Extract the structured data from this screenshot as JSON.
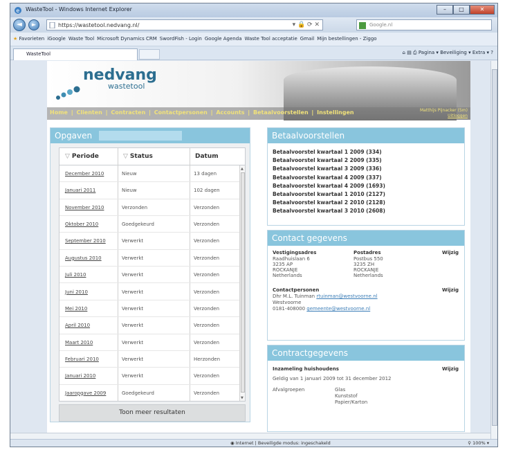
{
  "window": {
    "title": "WasteTool - Windows Internet Explorer",
    "btn_min": "–",
    "btn_max": "□",
    "btn_close": "✕"
  },
  "nav": {
    "back": "◄",
    "forward": "►",
    "address": "https://wastetool.nedvang.nl/",
    "search_placeholder": "Google.nl"
  },
  "favorites": {
    "label": "Favorieten",
    "items": [
      "iGoogle",
      "Waste Tool",
      "Microsoft Dynamics CRM",
      "SwordFish - Login",
      "Google Agenda",
      "Waste Tool acceptatie",
      "Gmail",
      "Mijn bestellingen - Ziggo"
    ]
  },
  "tab": {
    "label": "WasteTool"
  },
  "commandbar": {
    "pagina": "Pagina ▾",
    "beveiliging": "Beveiliging ▾",
    "extra": "Extra ▾"
  },
  "site": {
    "logo_main": "nedvang",
    "logo_sub": "wastetool",
    "menu": [
      "Home",
      "Clienten",
      "Contracten",
      "Contactpersonen",
      "Accounts",
      "Betaalvoorstellen",
      "Instellingen"
    ],
    "user": "Matthijs Pijnacker (5m)",
    "logout": "Uitloggen"
  },
  "opgaven": {
    "title": "Opgaven",
    "columns": [
      "Periode",
      "Status",
      "Datum"
    ],
    "rows": [
      {
        "periode": "December 2010",
        "status": "Nieuw",
        "datum": "13 dagen"
      },
      {
        "periode": "Januari 2011",
        "status": "Nieuw",
        "datum": "102 dagen"
      },
      {
        "periode": "November 2010",
        "status": "Verzonden",
        "datum": "Verzonden"
      },
      {
        "periode": "Oktober 2010",
        "status": "Goedgekeurd",
        "datum": "Verzonden"
      },
      {
        "periode": "September 2010",
        "status": "Verwerkt",
        "datum": "Verzonden"
      },
      {
        "periode": "Augustus 2010",
        "status": "Verwerkt",
        "datum": "Verzonden"
      },
      {
        "periode": "Juli 2010",
        "status": "Verwerkt",
        "datum": "Verzonden"
      },
      {
        "periode": "Juni 2010",
        "status": "Verwerkt",
        "datum": "Verzonden"
      },
      {
        "periode": "Mei 2010",
        "status": "Verwerkt",
        "datum": "Verzonden"
      },
      {
        "periode": "April 2010",
        "status": "Verwerkt",
        "datum": "Verzonden"
      },
      {
        "periode": "Maart 2010",
        "status": "Verwerkt",
        "datum": "Verzonden"
      },
      {
        "periode": "Februari 2010",
        "status": "Verwerkt",
        "datum": "Herzonden"
      },
      {
        "periode": "Januari 2010",
        "status": "Verwerkt",
        "datum": "Verzonden"
      },
      {
        "periode": "Jaaropgave 2009",
        "status": "Goedgekeurd",
        "datum": "Verzonden"
      }
    ],
    "more_button": "Toon meer resultaten"
  },
  "betaalvoorstellen": {
    "title": "Betaalvoorstellen",
    "items": [
      "Betaalvoorstel kwartaal 1 2009 (334)",
      "Betaalvoorstel kwartaal 2 2009 (335)",
      "Betaalvoorstel kwartaal 3 2009 (336)",
      "Betaalvoorstel kwartaal 4 2009 (337)",
      "Betaalvoorstel kwartaal 4 2009 (1693)",
      "Betaalvoorstel kwartaal 1 2010 (2127)",
      "Betaalvoorstel kwartaal 2 2010 (2128)",
      "Betaalvoorstel kwartaal 3 2010 (2608)"
    ]
  },
  "contact": {
    "title": "Contact gegevens",
    "vestiging_label": "Vestigingsadres",
    "vestiging": [
      "Raadhuislaan 6",
      "3235 AP",
      "ROCKANJE",
      "Netherlands"
    ],
    "post_label": "Postadres",
    "post": [
      "Postbus 550",
      "3235 ZH",
      "ROCKANJE",
      "Netherlands"
    ],
    "wijzig": "Wijzig",
    "persons_label": "Contactpersonen",
    "person_name": "Dhr M.L. Tuinman",
    "person_email": "rtuinman@westvoorne.nl",
    "person_org": "Westvoorne",
    "phone": "0181-408000",
    "phone_email": "gemeente@westvoorne.nl",
    "wijzig2": "Wijzig"
  },
  "contract": {
    "title": "Contractgegevens",
    "name": "Inzameling huishoudens",
    "wijzig": "Wijzig",
    "period": "Geldig van 1 januari 2009 tot 31 december 2012",
    "groups_label": "Afvalgroepen",
    "groups": [
      "Glas",
      "Kunststof",
      "Papier/Karton"
    ]
  },
  "status": {
    "zone": "Internet | Beveiligde modus: ingeschakeld",
    "zoom": "100%"
  },
  "colors": {
    "accent": "#89c5dd",
    "menu": "#f1e27a",
    "brand": "#2c6e90"
  }
}
